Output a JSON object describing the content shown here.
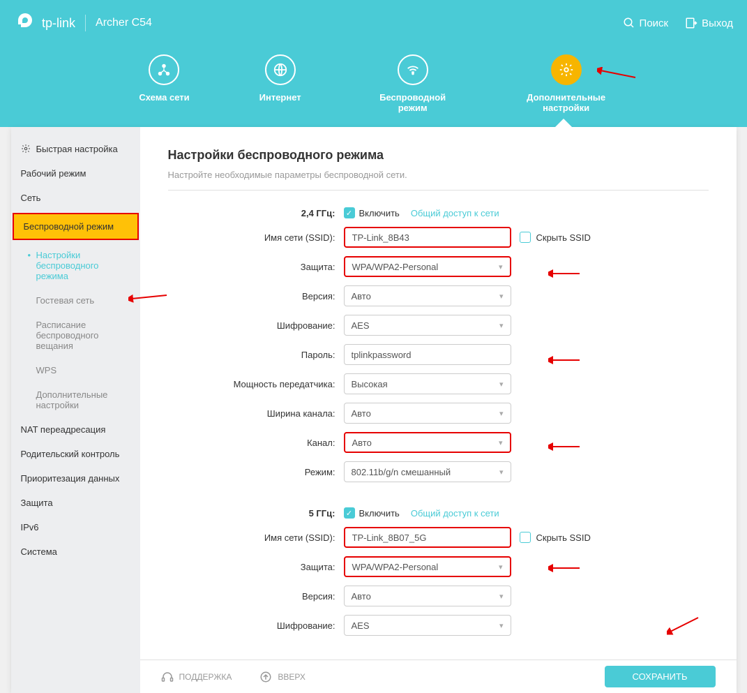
{
  "header": {
    "brand": "tp-link",
    "model": "Archer C54",
    "search": "Поиск",
    "logout": "Выход"
  },
  "tabs": {
    "network_map": "Схема сети",
    "internet": "Интернет",
    "wireless": "Беспроводной режим",
    "advanced": "Дополнительные настройки"
  },
  "menu": {
    "quick_setup": "Быстрая настройка",
    "operation_mode": "Рабочий режим",
    "network": "Сеть",
    "wireless": "Беспроводной режим",
    "sub": {
      "wireless_settings": "Настройки беспроводного режима",
      "guest_network": "Гостевая сеть",
      "wireless_schedule": "Расписание беспроводного вещания",
      "wps": "WPS",
      "advanced": "Дополнительные настройки"
    },
    "nat": "NAT переадресация",
    "parental": "Родительский контроль",
    "qos": "Приоритезация данных",
    "security": "Защита",
    "ipv6": "IPv6",
    "system": "Система"
  },
  "page": {
    "title": "Настройки беспроводного режима",
    "subtitle": "Настройте необходимые параметры беспроводной сети."
  },
  "labels": {
    "ghz24": "2,4 ГГц:",
    "ghz5": "5 ГГц:",
    "enable": "Включить",
    "sharing": "Общий доступ к сети",
    "ssid": "Имя сети (SSID):",
    "hide_ssid": "Скрыть SSID",
    "security": "Защита:",
    "version": "Версия:",
    "encryption": "Шифрование:",
    "password": "Пароль:",
    "tx_power": "Мощность передатчика:",
    "channel_width": "Ширина канала:",
    "channel": "Канал:",
    "mode": "Режим:"
  },
  "values": {
    "ssid_24": "TP-Link_8B43",
    "ssid_5": "TP-Link_8B07_5G",
    "security_val": "WPA/WPA2-Personal",
    "version_val": "Авто",
    "encryption_val": "AES",
    "password_val": "tplinkpassword",
    "tx_power_val": "Высокая",
    "channel_width_val": "Авто",
    "channel_val": "Авто",
    "mode_val": "802.11b/g/n смешанный"
  },
  "footer": {
    "support": "ПОДДЕРЖКА",
    "top": "ВВЕРХ",
    "save": "СОХРАНИТЬ"
  }
}
